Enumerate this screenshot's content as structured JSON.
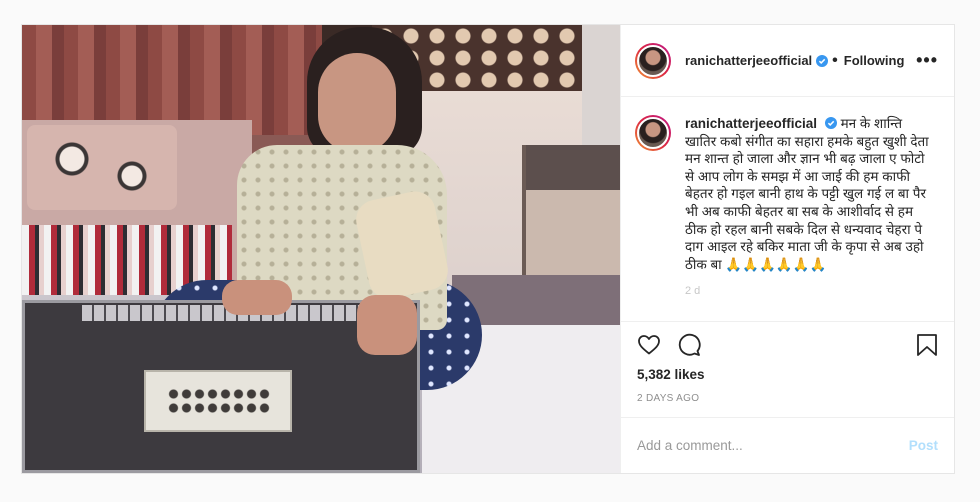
{
  "header": {
    "username": "ranichatterjeeofficial",
    "separator": "•",
    "follow_status": "Following",
    "more_icon": "more-horizontal-icon"
  },
  "caption": {
    "username": "ranichatterjeeofficial",
    "text": "मन के शान्ति खातिर कबो संगीत का सहारा हमके बहुत खुशी देता मन शान्त हो जाला और ज्ञान भी बढ़ जाला ए फोटो से आप लोग के समझ में आ जाई की हम काफी बेहतर हो गइल बानी हाथ के पट्टी खुल गई ल बा पैर भी अब काफी बेहतर बा सब के आशीर्वाद से हम ठीक हो रहल बानी सबके दिल से धन्यवाद चेहरा पे दाग आइल रहे बकिर माता जी के कृपा से अब उहो ठीक बा 🙏🙏🙏🙏🙏🙏",
    "time_partial": "2 d"
  },
  "actions": {
    "like_icon": "heart-icon",
    "comment_icon": "comment-icon",
    "save_icon": "bookmark-icon"
  },
  "likes": "5,382 likes",
  "date": "2 DAYS AGO",
  "comment_box": {
    "placeholder": "Add a comment...",
    "post_label": "Post"
  },
  "colors": {
    "verified": "#3897f0",
    "post_disabled": "#b2dffc",
    "border": "#efefef"
  }
}
